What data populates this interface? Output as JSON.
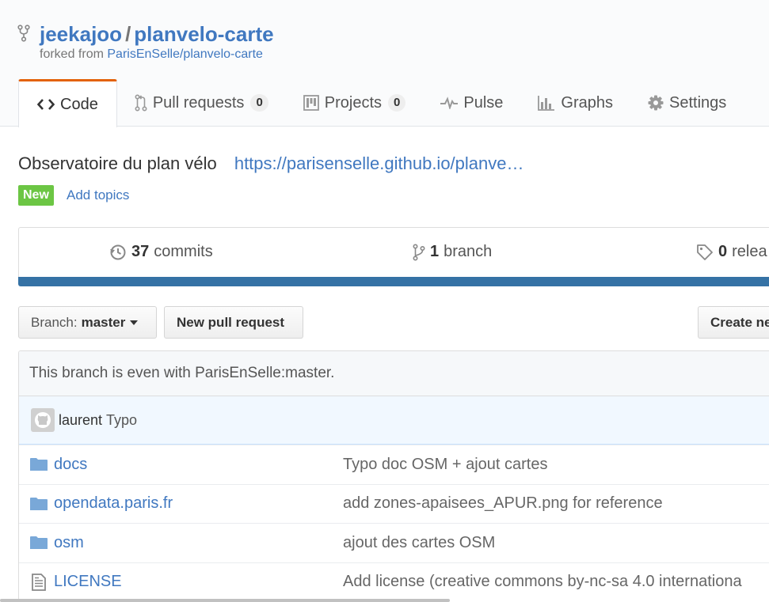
{
  "repo": {
    "owner": "jeekajoo",
    "separator": "/",
    "name": "planvelo-carte",
    "forked_prefix": "forked from",
    "forked_source": "ParisEnSelle/planvelo-carte"
  },
  "tabs": [
    {
      "label": "Code",
      "icon": "code-icon",
      "selected": true
    },
    {
      "label": "Pull requests",
      "icon": "pull-request-icon",
      "count": "0"
    },
    {
      "label": "Projects",
      "icon": "project-icon",
      "count": "0"
    },
    {
      "label": "Pulse",
      "icon": "pulse-icon"
    },
    {
      "label": "Graphs",
      "icon": "graph-icon"
    },
    {
      "label": "Settings",
      "icon": "gear-icon"
    }
  ],
  "description": {
    "text": "Observatoire du plan vélo",
    "url": "https://parisenselle.github.io/planve…",
    "new_badge": "New",
    "add_topics": "Add topics"
  },
  "summary": {
    "commits_count": "37",
    "commits_label": "commits",
    "branches_count": "1",
    "branches_label": "branch",
    "releases_count": "0",
    "releases_label": "relea"
  },
  "colors": {
    "link": "#4078c0",
    "lang_bar": "#3572a5",
    "new_badge": "#6cc644",
    "selected_tab": "#e36209"
  },
  "actions": {
    "branch_prefix": "Branch:",
    "branch_name": "master",
    "new_pull_request": "New pull request",
    "create_new": "Create ne"
  },
  "branch_status": "This branch is even with ParisEnSelle:master.",
  "latest_commit": {
    "author": "laurent",
    "message": "Typo"
  },
  "files": [
    {
      "type": "folder",
      "name": "docs",
      "message": "Typo doc OSM + ajout cartes"
    },
    {
      "type": "folder",
      "name": "opendata.paris.fr",
      "message": "add zones-apaisees_APUR.png for reference"
    },
    {
      "type": "folder",
      "name": "osm",
      "message": "ajout des cartes OSM"
    },
    {
      "type": "file",
      "name": "LICENSE",
      "message": "Add license (creative commons by-nc-sa 4.0 internationa"
    }
  ]
}
